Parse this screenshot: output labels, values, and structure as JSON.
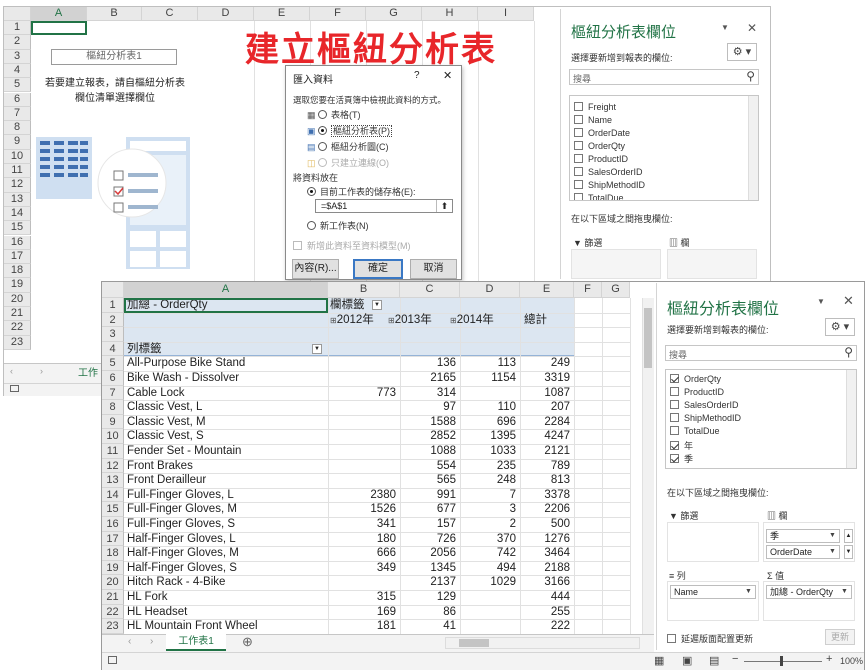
{
  "back": {
    "columns": [
      "A",
      "B",
      "C",
      "D",
      "E",
      "F",
      "G",
      "H",
      "I"
    ],
    "rows": [
      "1",
      "2",
      "3",
      "4",
      "5",
      "6",
      "7",
      "8",
      "9",
      "10",
      "11",
      "12",
      "13",
      "14",
      "15",
      "16",
      "17",
      "18",
      "19",
      "20",
      "21",
      "22",
      "23"
    ],
    "pivot_placeholder": "樞紐分析表1",
    "instruction_line1": "若要建立報表，請自樞紐分析表",
    "instruction_line2": "欄位清單選擇欄位",
    "sheet_tab": "工作"
  },
  "big_title": "建立樞紐分析表",
  "dialog": {
    "title": "匯入資料",
    "help": "?",
    "close": "✕",
    "prompt": "選取您要在活頁簿中檢視此資料的方式。",
    "options": [
      "表格(T)",
      "樞紐分析表(P)",
      "樞紐分析圖(C)",
      "只建立連線(O)"
    ],
    "location_prompt": "將資料放在",
    "existing_sheet": "目前工作表的儲存格(E):",
    "range_value": "=$A$1",
    "new_sheet": "新工作表(N)",
    "add_model": "新增此資料至資料模型(M)",
    "properties_button": "內容(R)...",
    "ok_button": "確定",
    "cancel_button": "取消"
  },
  "back_pane": {
    "title": "樞紐分析表欄位",
    "subtitle": "選擇要新增到報表的欄位:",
    "search_placeholder": "搜尋",
    "fields": [
      "Freight",
      "Name",
      "OrderDate",
      "OrderQty",
      "ProductID",
      "SalesOrderID",
      "ShipMethodID",
      "TotalDue"
    ],
    "drag_hint": "在以下區域之間拖曳欄位:",
    "filters_label": "篩選",
    "columns_label": "欄"
  },
  "front": {
    "columns": [
      "A",
      "B",
      "C",
      "D",
      "E",
      "F",
      "G"
    ],
    "rows": [
      "1",
      "2",
      "3",
      "4",
      "5",
      "6",
      "7",
      "8",
      "9",
      "10",
      "11",
      "12",
      "13",
      "14",
      "15",
      "16",
      "17",
      "18",
      "19",
      "20",
      "21",
      "22",
      "23"
    ],
    "header_row1": {
      "a": "加總 - OrderQty",
      "b": "欄標籤"
    },
    "years": [
      "2012年",
      "2013年",
      "2014年"
    ],
    "total_label": "總計",
    "row_label_header": "列標籤",
    "data": [
      {
        "name": "All-Purpose Bike Stand",
        "y2012": "",
        "y2013": "136",
        "y2014": "113",
        "total": "249"
      },
      {
        "name": "Bike Wash - Dissolver",
        "y2012": "",
        "y2013": "2165",
        "y2014": "1154",
        "total": "3319"
      },
      {
        "name": "Cable Lock",
        "y2012": "773",
        "y2013": "314",
        "y2014": "",
        "total": "1087"
      },
      {
        "name": "Classic Vest, L",
        "y2012": "",
        "y2013": "97",
        "y2014": "110",
        "total": "207"
      },
      {
        "name": "Classic Vest, M",
        "y2012": "",
        "y2013": "1588",
        "y2014": "696",
        "total": "2284"
      },
      {
        "name": "Classic Vest, S",
        "y2012": "",
        "y2013": "2852",
        "y2014": "1395",
        "total": "4247"
      },
      {
        "name": "Fender Set - Mountain",
        "y2012": "",
        "y2013": "1088",
        "y2014": "1033",
        "total": "2121"
      },
      {
        "name": "Front Brakes",
        "y2012": "",
        "y2013": "554",
        "y2014": "235",
        "total": "789"
      },
      {
        "name": "Front Derailleur",
        "y2012": "",
        "y2013": "565",
        "y2014": "248",
        "total": "813"
      },
      {
        "name": "Full-Finger Gloves, L",
        "y2012": "2380",
        "y2013": "991",
        "y2014": "7",
        "total": "3378"
      },
      {
        "name": "Full-Finger Gloves, M",
        "y2012": "1526",
        "y2013": "677",
        "y2014": "3",
        "total": "2206"
      },
      {
        "name": "Full-Finger Gloves, S",
        "y2012": "341",
        "y2013": "157",
        "y2014": "2",
        "total": "500"
      },
      {
        "name": "Half-Finger Gloves, L",
        "y2012": "180",
        "y2013": "726",
        "y2014": "370",
        "total": "1276"
      },
      {
        "name": "Half-Finger Gloves, M",
        "y2012": "666",
        "y2013": "2056",
        "y2014": "742",
        "total": "3464"
      },
      {
        "name": "Half-Finger Gloves, S",
        "y2012": "349",
        "y2013": "1345",
        "y2014": "494",
        "total": "2188"
      },
      {
        "name": "Hitch Rack - 4-Bike",
        "y2012": "",
        "y2013": "2137",
        "y2014": "1029",
        "total": "3166"
      },
      {
        "name": "HL Fork",
        "y2012": "315",
        "y2013": "129",
        "y2014": "",
        "total": "444"
      },
      {
        "name": "HL Headset",
        "y2012": "169",
        "y2013": "86",
        "y2014": "",
        "total": "255"
      },
      {
        "name": "HL Mountain Front Wheel",
        "y2012": "181",
        "y2013": "41",
        "y2014": "",
        "total": "222"
      }
    ],
    "sheet_tab": "工作表1",
    "add_sheet": "⊕"
  },
  "front_pane": {
    "title": "樞紐分析表欄位",
    "subtitle": "選擇要新增到報表的欄位:",
    "search_placeholder": "搜尋",
    "fields": [
      {
        "label": "OrderQty",
        "checked": true
      },
      {
        "label": "ProductID",
        "checked": false
      },
      {
        "label": "SalesOrderID",
        "checked": false
      },
      {
        "label": "ShipMethodID",
        "checked": false
      },
      {
        "label": "TotalDue",
        "checked": false
      },
      {
        "label": "年",
        "checked": true
      },
      {
        "label": "季",
        "checked": true
      }
    ],
    "drag_hint": "在以下區域之間拖曳欄位:",
    "filters_label": "篩選",
    "columns_label": "欄",
    "column_items": [
      "季",
      "OrderDate"
    ],
    "rows_label": "列",
    "values_label": "值",
    "row_items": [
      "Name"
    ],
    "value_items": [
      "加總 - OrderQty"
    ],
    "defer_update": "延遲版面配置更新",
    "update_button": "更新",
    "zoom": "100%"
  },
  "colors": {
    "accent": "#217346",
    "pivot_header_bg": "#dce6f1",
    "title_red": "#e8262a"
  }
}
